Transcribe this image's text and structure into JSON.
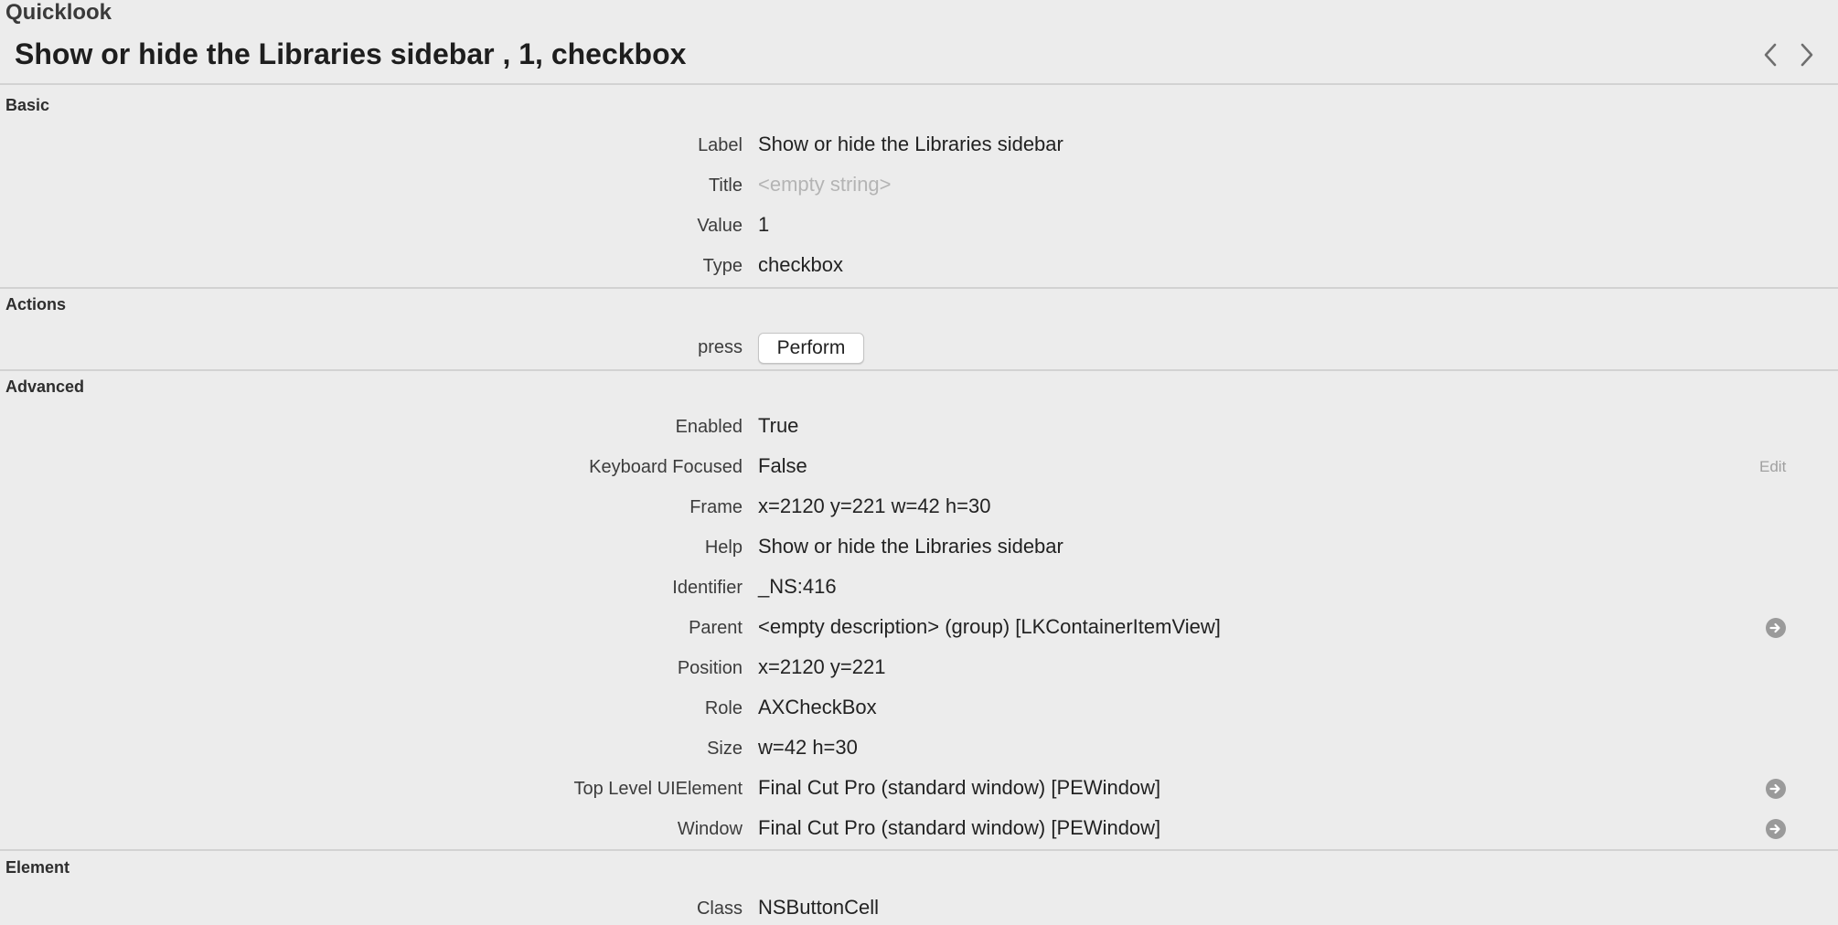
{
  "app_title": "Quicklook",
  "element_heading": "Show or hide the Libraries sidebar ,  1, checkbox",
  "icons": {
    "prev": "chevron-left-icon",
    "next": "chevron-right-icon",
    "go": "arrow-right-circle-icon"
  },
  "sections": {
    "basic": {
      "header": "Basic",
      "rows": [
        {
          "label": "Label",
          "value": "Show or hide the Libraries sidebar"
        },
        {
          "label": "Title",
          "value": "<empty string>"
        },
        {
          "label": "Value",
          "value": "1"
        },
        {
          "label": "Type",
          "value": "checkbox"
        }
      ]
    },
    "actions": {
      "header": "Actions",
      "rows": [
        {
          "label": "press",
          "button": "Perform"
        }
      ]
    },
    "advanced": {
      "header": "Advanced",
      "edit_label": "Edit",
      "rows": [
        {
          "label": "Enabled",
          "value": "True"
        },
        {
          "label": "Keyboard Focused",
          "value": "False"
        },
        {
          "label": "Frame",
          "value": "x=2120 y=221 w=42 h=30"
        },
        {
          "label": "Help",
          "value": "Show or hide the Libraries sidebar"
        },
        {
          "label": "Identifier",
          "value": "_NS:416"
        },
        {
          "label": "Parent",
          "value": "<empty description> (group) [LKContainerItemView]"
        },
        {
          "label": "Position",
          "value": "x=2120 y=221"
        },
        {
          "label": "Role",
          "value": "AXCheckBox"
        },
        {
          "label": "Size",
          "value": "w=42 h=30"
        },
        {
          "label": "Top Level UIElement",
          "value": "Final Cut Pro (standard window) [PEWindow]"
        },
        {
          "label": "Window",
          "value": "Final Cut Pro (standard window) [PEWindow]"
        }
      ]
    },
    "element": {
      "header": "Element",
      "rows": [
        {
          "label": "Class",
          "value": "NSButtonCell"
        }
      ]
    }
  }
}
